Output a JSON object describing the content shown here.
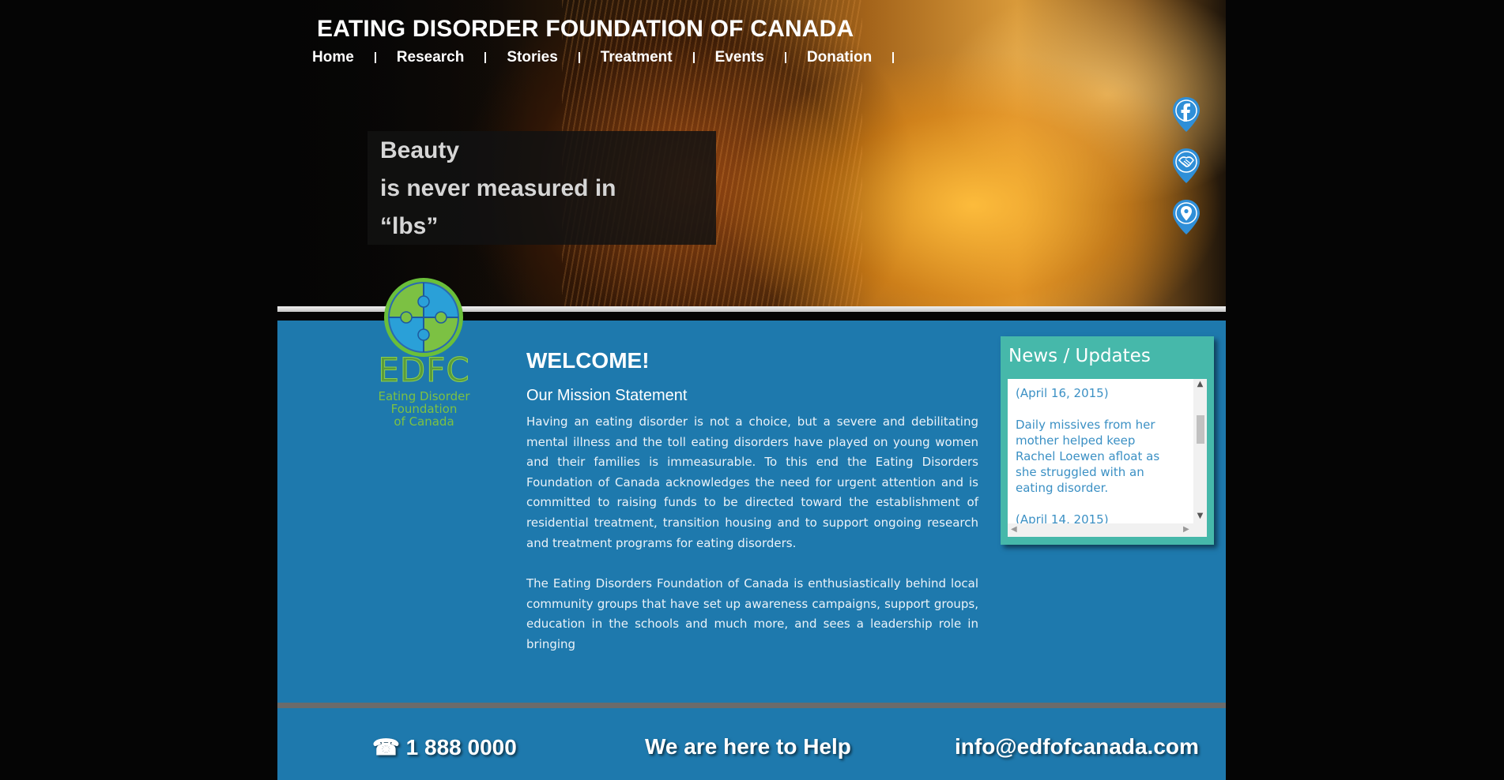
{
  "header": {
    "site_title": "EATING DISORDER FOUNDATION OF CANADA",
    "nav": [
      "Home",
      "Research",
      "Stories",
      "Treatment",
      "Events",
      "Donation"
    ]
  },
  "hero": {
    "tagline": [
      "Beauty",
      "is never measured in",
      "“lbs”"
    ]
  },
  "social": [
    "facebook-icon",
    "support-icon",
    "location-icon"
  ],
  "logo": {
    "acronym": "EDFC",
    "name_lines": [
      "Eating Disorder",
      "Foundation",
      "of Canada"
    ]
  },
  "main": {
    "welcome": "WELCOME!",
    "mission_title": "Our Mission Statement",
    "paragraphs": [
      "Having an eating disorder is not a choice, but a severe and debilitating mental illness and the toll eating disorders have played on young women and their families is immeasurable. To this end the Eating Disorders Foundation of Canada acknowledges the need for urgent attention and is committed to raising funds to be directed toward the establishment of residential treatment, transition housing and to support ongoing research and treatment programs for eating disorders.",
      "The Eating Disorders Foundation of Canada is enthusiastically behind local community groups that have set up awareness campaigns, support groups, education in the schools and much more, and sees a leadership role in bringing"
    ]
  },
  "news": {
    "title": "News / Updates",
    "items": [
      {
        "date": "(April 16, 2015)",
        "text": "Daily missives from her mother helped keep Rachel Loewen afloat as she struggled with an eating disorder."
      },
      {
        "date": "(April 14, 2015)",
        "text": ""
      }
    ]
  },
  "footer": {
    "phone_icon": "☎",
    "phone": "1 888 0000",
    "slogan": "We are here to Help",
    "email": "info@edfofcanada.com"
  },
  "colors": {
    "main_blue": "#1e79ad",
    "news_teal": "#46b8aa",
    "logo_green": "#7cc143",
    "social_blue": "#2f8fd8"
  }
}
